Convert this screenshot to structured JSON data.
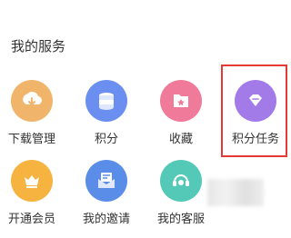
{
  "section": {
    "title": "我的服务"
  },
  "items": [
    {
      "label": "下载管理",
      "icon": "download-icon",
      "color": "#f0b46a"
    },
    {
      "label": "积分",
      "icon": "coins-icon",
      "color": "#6a8ff0"
    },
    {
      "label": "收藏",
      "icon": "bookmark-folder-icon",
      "color": "#f07a9a"
    },
    {
      "label": "积分任务",
      "icon": "diamond-tag-icon",
      "color": "#a37be8"
    },
    {
      "label": "开通会员",
      "icon": "crown-icon",
      "color": "#f6b33f"
    },
    {
      "label": "我的邀请",
      "icon": "invite-mail-icon",
      "color": "#5a8de8"
    },
    {
      "label": "我的客服",
      "icon": "customer-service-icon",
      "color": "#55c9b7"
    }
  ],
  "colors": {
    "highlight": "#e53935"
  }
}
